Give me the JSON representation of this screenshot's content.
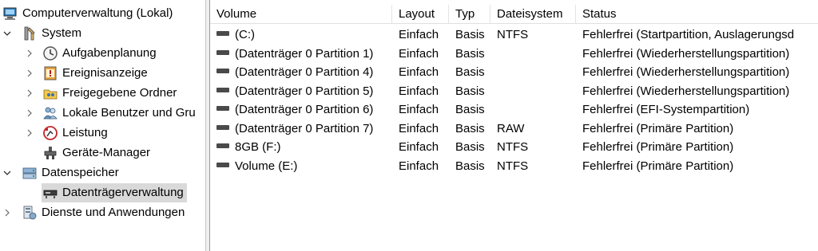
{
  "tree": {
    "root": "Computerverwaltung (Lokal)",
    "system": "System",
    "aufgabenplanung": "Aufgabenplanung",
    "ereignisanzeige": "Ereignisanzeige",
    "freigegebene_ordner": "Freigegebene Ordner",
    "lokale_benutzer": "Lokale Benutzer und Gru",
    "leistung": "Leistung",
    "geraete_manager": "Geräte-Manager",
    "datenspeicher": "Datenspeicher",
    "datentraegerverwaltung": "Datenträgerverwaltung",
    "dienste": "Dienste und Anwendungen"
  },
  "columns": {
    "volume": "Volume",
    "layout": "Layout",
    "typ": "Typ",
    "dateisystem": "Dateisystem",
    "status": "Status"
  },
  "rows": [
    {
      "volume": "(C:)",
      "layout": "Einfach",
      "typ": "Basis",
      "dateisystem": "NTFS",
      "status": "Fehlerfrei (Startpartition, Auslagerungsd"
    },
    {
      "volume": "(Datenträger 0 Partition 1)",
      "layout": "Einfach",
      "typ": "Basis",
      "dateisystem": "",
      "status": "Fehlerfrei (Wiederherstellungspartition)"
    },
    {
      "volume": "(Datenträger 0 Partition 4)",
      "layout": "Einfach",
      "typ": "Basis",
      "dateisystem": "",
      "status": "Fehlerfrei (Wiederherstellungspartition)"
    },
    {
      "volume": "(Datenträger 0 Partition 5)",
      "layout": "Einfach",
      "typ": "Basis",
      "dateisystem": "",
      "status": "Fehlerfrei (Wiederherstellungspartition)"
    },
    {
      "volume": "(Datenträger 0 Partition 6)",
      "layout": "Einfach",
      "typ": "Basis",
      "dateisystem": "",
      "status": "Fehlerfrei (EFI-Systempartition)"
    },
    {
      "volume": "(Datenträger 0 Partition 7)",
      "layout": "Einfach",
      "typ": "Basis",
      "dateisystem": "RAW",
      "status": "Fehlerfrei (Primäre Partition)"
    },
    {
      "volume": "8GB (F:)",
      "layout": "Einfach",
      "typ": "Basis",
      "dateisystem": "NTFS",
      "status": "Fehlerfrei (Primäre Partition)"
    },
    {
      "volume": "Volume (E:)",
      "layout": "Einfach",
      "typ": "Basis",
      "dateisystem": "NTFS",
      "status": "Fehlerfrei (Primäre Partition)"
    }
  ],
  "icons": {
    "computer": "computer-management-icon",
    "system": "system-tools-icon",
    "scheduler": "task-scheduler-icon",
    "events": "event-viewer-icon",
    "shared": "shared-folders-icon",
    "users": "local-users-icon",
    "performance": "performance-icon",
    "devices": "device-manager-icon",
    "storage": "storage-icon",
    "disk": "disk-management-icon",
    "services": "services-icon",
    "volume": "volume-drive-icon"
  }
}
